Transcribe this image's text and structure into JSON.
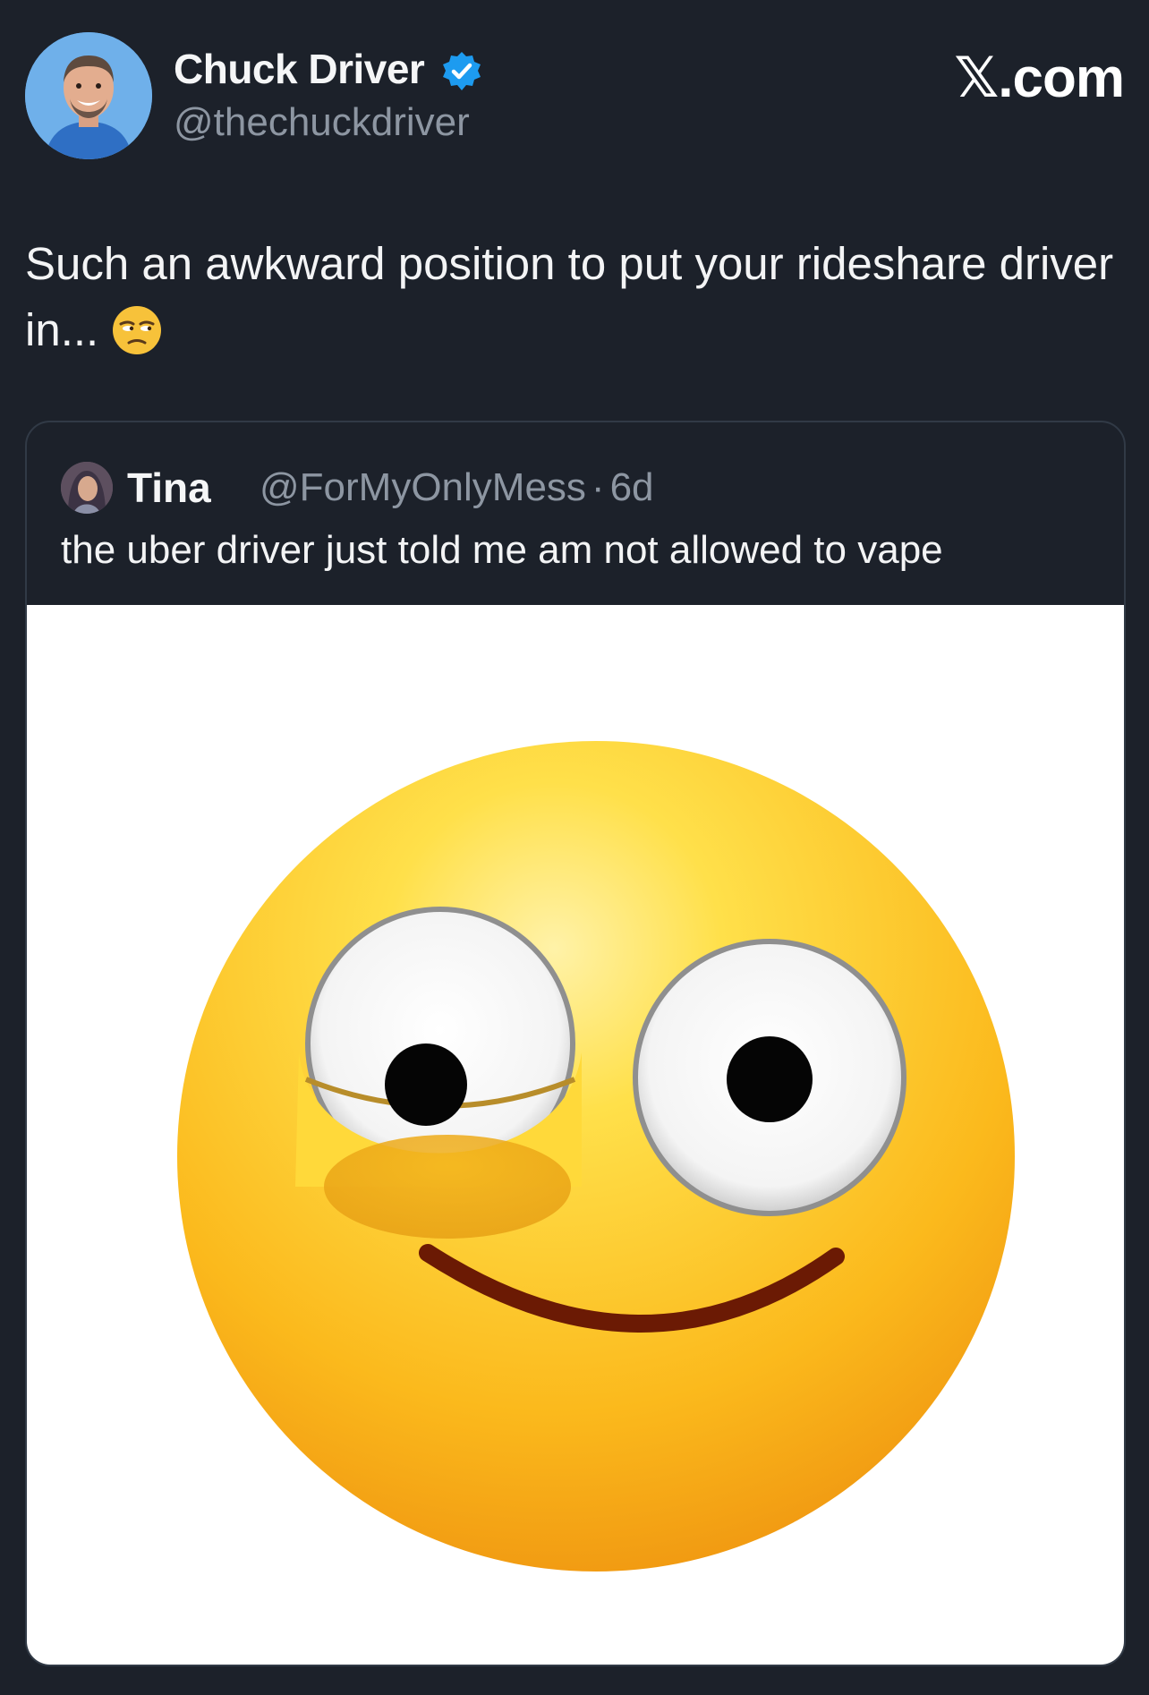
{
  "author": {
    "name": "Chuck Driver",
    "handle": "@thechuckdriver",
    "verified": true,
    "avatar_icon": "profile-photo-avatar"
  },
  "site": {
    "label": "𝕏.com"
  },
  "tweet": {
    "text": "Such an awkward position to put your rideshare driver in...",
    "emoji_icon": "unamused-face-emoji"
  },
  "quoted_tweet": {
    "name": "Tina",
    "handle": "@ForMyOnlyMess",
    "separator": "·",
    "time": "6d",
    "text": "the uber driver just told me am not allowed to vape",
    "media_icon": "side-eye-face-emoji-image"
  },
  "colors": {
    "background": "#1c212a",
    "verified_blue": "#1d9bf0",
    "secondary_text": "#8d96a2",
    "card_border": "#313a46"
  }
}
